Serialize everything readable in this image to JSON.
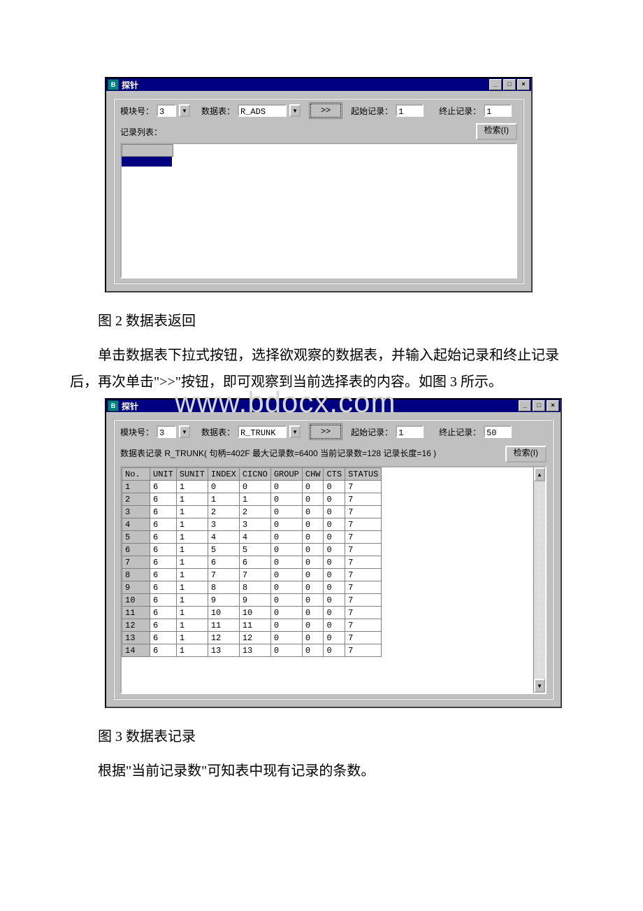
{
  "watermark": "www.bdocx.com",
  "win1": {
    "title": "探针",
    "labels": {
      "module": "模块号：",
      "table": "数据表：",
      "start": "起始记录：",
      "end": "终止记录：",
      "listlabel": "记录列表：",
      "go": ">>",
      "search": "检索(I)"
    },
    "values": {
      "module": "3",
      "table": "R_ADS",
      "start": "1",
      "end": "1"
    }
  },
  "caption1": "图 2 数据表返回",
  "para1": "单击数据表下拉式按钮，选择欲观察的数据表，并输入起始记录和终止记录后，再次单击\">>\"按钮，即可观察到当前选择表的内容。如图 3 所示。",
  "win2": {
    "title": "探针",
    "labels": {
      "module": "模块号：",
      "table": "数据表：",
      "start": "起始记录：",
      "end": "终止记录：",
      "go": ">>",
      "search": "检索(I)"
    },
    "values": {
      "module": "3",
      "table": "R_TRUNK",
      "start": "1",
      "end": "50"
    },
    "status": "数据表记录 R_TRUNK(  句柄=402F  最大记录数=6400  当前记录数=128  记录长度=16  )",
    "columns": [
      "No.",
      "UNIT",
      "SUNIT",
      "INDEX",
      "CICNO",
      "GROUP",
      "CHW",
      "CTS",
      "STATUS"
    ],
    "rows": [
      {
        "no": "1",
        "unit": "6",
        "sunit": "1",
        "index": "0",
        "cicno": "0",
        "group": "0",
        "chw": "0",
        "cts": "0",
        "status": "7"
      },
      {
        "no": "2",
        "unit": "6",
        "sunit": "1",
        "index": "1",
        "cicno": "1",
        "group": "0",
        "chw": "0",
        "cts": "0",
        "status": "7"
      },
      {
        "no": "3",
        "unit": "6",
        "sunit": "1",
        "index": "2",
        "cicno": "2",
        "group": "0",
        "chw": "0",
        "cts": "0",
        "status": "7"
      },
      {
        "no": "4",
        "unit": "6",
        "sunit": "1",
        "index": "3",
        "cicno": "3",
        "group": "0",
        "chw": "0",
        "cts": "0",
        "status": "7"
      },
      {
        "no": "5",
        "unit": "6",
        "sunit": "1",
        "index": "4",
        "cicno": "4",
        "group": "0",
        "chw": "0",
        "cts": "0",
        "status": "7"
      },
      {
        "no": "6",
        "unit": "6",
        "sunit": "1",
        "index": "5",
        "cicno": "5",
        "group": "0",
        "chw": "0",
        "cts": "0",
        "status": "7"
      },
      {
        "no": "7",
        "unit": "6",
        "sunit": "1",
        "index": "6",
        "cicno": "6",
        "group": "0",
        "chw": "0",
        "cts": "0",
        "status": "7"
      },
      {
        "no": "8",
        "unit": "6",
        "sunit": "1",
        "index": "7",
        "cicno": "7",
        "group": "0",
        "chw": "0",
        "cts": "0",
        "status": "7"
      },
      {
        "no": "9",
        "unit": "6",
        "sunit": "1",
        "index": "8",
        "cicno": "8",
        "group": "0",
        "chw": "0",
        "cts": "0",
        "status": "7"
      },
      {
        "no": "10",
        "unit": "6",
        "sunit": "1",
        "index": "9",
        "cicno": "9",
        "group": "0",
        "chw": "0",
        "cts": "0",
        "status": "7"
      },
      {
        "no": "11",
        "unit": "6",
        "sunit": "1",
        "index": "10",
        "cicno": "10",
        "group": "0",
        "chw": "0",
        "cts": "0",
        "status": "7"
      },
      {
        "no": "12",
        "unit": "6",
        "sunit": "1",
        "index": "11",
        "cicno": "11",
        "group": "0",
        "chw": "0",
        "cts": "0",
        "status": "7"
      },
      {
        "no": "13",
        "unit": "6",
        "sunit": "1",
        "index": "12",
        "cicno": "12",
        "group": "0",
        "chw": "0",
        "cts": "0",
        "status": "7"
      },
      {
        "no": "14",
        "unit": "6",
        "sunit": "1",
        "index": "13",
        "cicno": "13",
        "group": "0",
        "chw": "0",
        "cts": "0",
        "status": "7"
      }
    ]
  },
  "caption2": "图 3  数据表记录",
  "para2": "根据\"当前记录数\"可知表中现有记录的条数。"
}
